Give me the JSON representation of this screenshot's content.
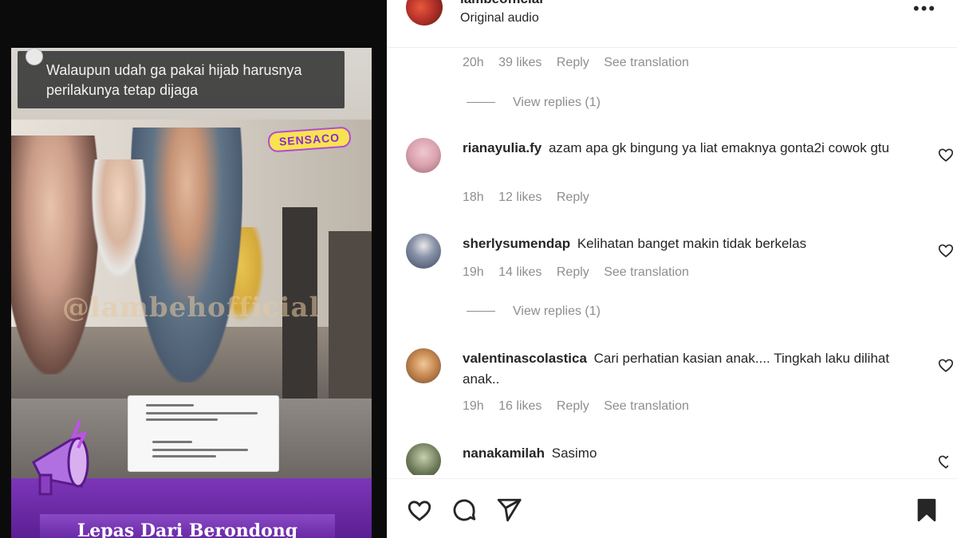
{
  "media": {
    "quote_text": "Walaupun udah ga pakai hijab harusnya perilakunya tetap dijaga",
    "sticker_text": "SENSACO",
    "watermark": "@lambehofficial",
    "banner_text": "Lepas Dari Berondong"
  },
  "header": {
    "username": "lambeofficial",
    "audio": "Original audio",
    "more_icon": "more-horizontal-icon"
  },
  "comments": [
    {
      "meta": {
        "time": "20h",
        "likes": "39 likes",
        "reply": "Reply",
        "translation": "See translation"
      },
      "view_replies": "View replies (1)"
    },
    {
      "username": "rianayulia.fy",
      "text": "azam apa gk bingung ya liat emaknya gonta2i cowok gtu",
      "meta": {
        "time": "18h",
        "likes": "12 likes",
        "reply": "Reply"
      },
      "avatar_color": "#d9a2ae"
    },
    {
      "username": "sherlysumendap",
      "text": "Kelihatan banget makin tidak berkelas",
      "meta": {
        "time": "19h",
        "likes": "14 likes",
        "reply": "Reply",
        "translation": "See translation"
      },
      "view_replies": "View replies (1)",
      "avatar_color": "#3d4a66"
    },
    {
      "username": "valentinascolastica",
      "text": "Cari perhatian kasian anak.... Tingkah laku dilihat anak..",
      "meta": {
        "time": "19h",
        "likes": "16 likes",
        "reply": "Reply",
        "translation": "See translation"
      },
      "avatar_color": "#c98a52"
    },
    {
      "username": "nanakamilah",
      "text": "Sasimo",
      "avatar_color": "#6f7c5a"
    }
  ],
  "actions": {
    "like_icon": "heart-icon",
    "comment_icon": "comment-icon",
    "share_icon": "share-icon",
    "save_icon": "bookmark-icon"
  },
  "colors": {
    "text": "#262626",
    "muted": "#8e8e8e",
    "banner_purple": "#6a2aa6"
  }
}
